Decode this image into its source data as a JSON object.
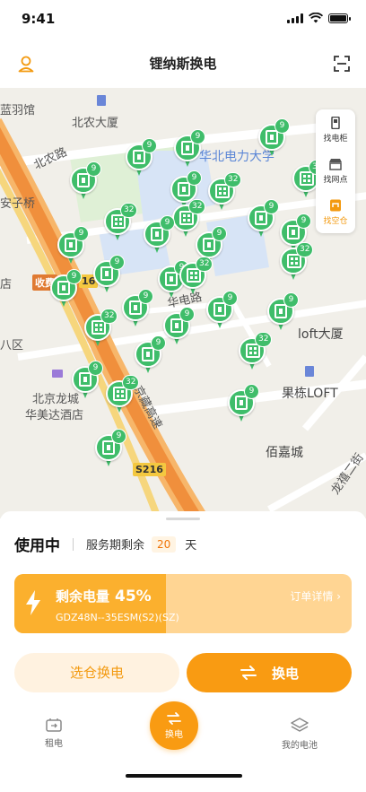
{
  "status_bar": {
    "time": "9:41"
  },
  "header": {
    "title": "锂纳斯换电",
    "left_icon": "user-icon",
    "right_icon": "scan-icon"
  },
  "map": {
    "labels": [
      "蓝羽馆",
      "北农大厦",
      "北农路",
      "华北电力大学",
      "安子桥",
      "收费",
      "16",
      "华电路",
      "loft大厦",
      "八区",
      "北京龙城",
      "华美达酒店",
      "果栋LOFT",
      "佰嘉城",
      "京藏高速",
      "S216",
      "龙禧二街",
      "店"
    ],
    "pin_counts": [
      "9",
      "32"
    ],
    "tools": [
      {
        "label": "找电柜",
        "icon": "cabinet-icon"
      },
      {
        "label": "找网点",
        "icon": "store-icon"
      },
      {
        "label": "找空仓",
        "icon": "empty-slot-icon"
      }
    ]
  },
  "sheet": {
    "status": "使用中",
    "service_prefix": "服务期剩余",
    "days": "20",
    "days_unit": "天",
    "battery": {
      "title": "剩余电量",
      "percent_text": "45%",
      "level": 0.45,
      "model": "GDZ48N--35ESM(S2)(SZ)",
      "detail_link": "订单详情 ›"
    },
    "select_button": "选仓换电",
    "swap_button": "换电"
  },
  "tabbar": {
    "items": [
      {
        "label": "租电",
        "icon": "rent-battery-icon"
      },
      {
        "label": "换电",
        "icon": "swap-icon"
      },
      {
        "label": "我的电池",
        "icon": "layers-icon"
      }
    ]
  },
  "colors": {
    "accent": "#f99b12",
    "pin_green": "#3fbd6a",
    "map_bg": "#f1efe9"
  }
}
